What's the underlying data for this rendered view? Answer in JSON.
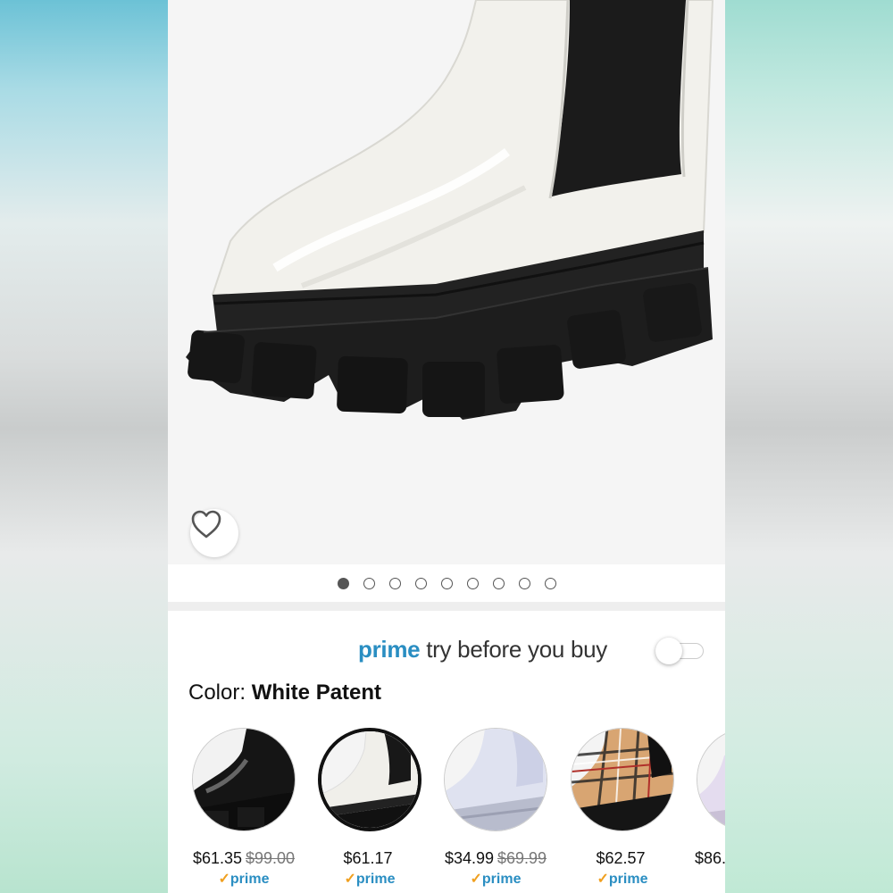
{
  "colors": {
    "prime_blue": "#2a8ec2",
    "check_orange": "#f0a020"
  },
  "hero": {
    "wishlist_icon": "heart-outline-icon",
    "image_count": 9,
    "active_index": 0
  },
  "prime": {
    "brand": "prime",
    "text": "try before you buy",
    "toggle_on": false
  },
  "color": {
    "label": "Color:",
    "selected": "White Patent"
  },
  "swatches": [
    {
      "price": "$61.35",
      "list_price": "$99.00",
      "badge": "prime",
      "selected": false
    },
    {
      "price": "$61.17",
      "list_price": "",
      "badge": "prime",
      "selected": true
    },
    {
      "price": "$34.99",
      "list_price": "$69.99",
      "badge": "prime",
      "selected": false
    },
    {
      "price": "$62.57",
      "list_price": "",
      "badge": "prime",
      "selected": false
    },
    {
      "price": "$86.",
      "list_price": "",
      "badge": "",
      "selected": false
    }
  ]
}
